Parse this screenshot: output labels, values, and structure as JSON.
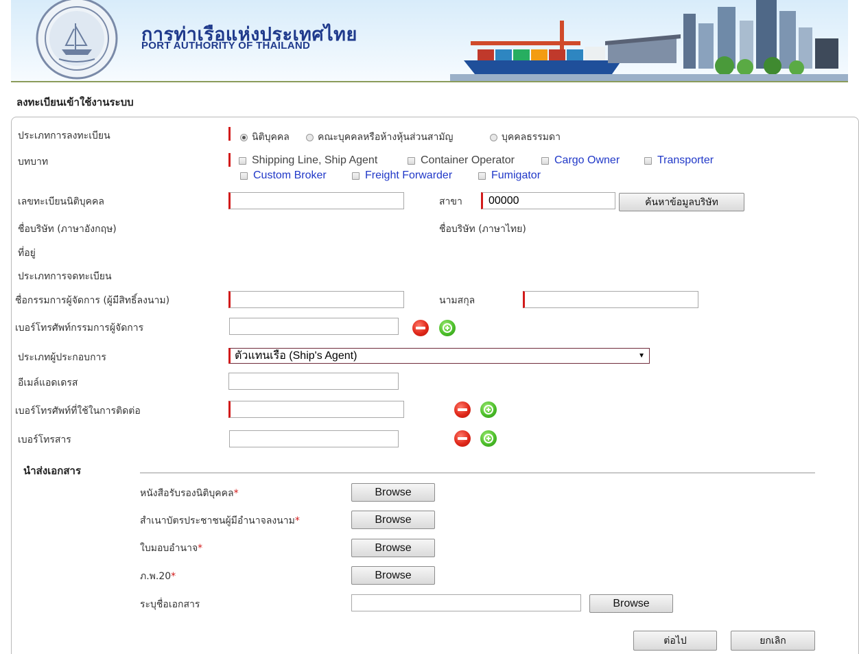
{
  "header": {
    "brand_th": "การท่าเรือแห่งประเทศไทย",
    "brand_en": "PORT AUTHORITY OF THAILAND"
  },
  "page_title": "ลงทะเบียนเข้าใช้งานระบบ",
  "form": {
    "reg_type": {
      "label": "ประเภทการลงทะเบียน",
      "options": [
        "นิติบุคคล",
        "คณะบุคคลหรือห้างหุ้นส่วนสามัญ",
        "บุคคลธรรมดา"
      ],
      "selected": "นิติบุคคล"
    },
    "role": {
      "label": "บทบาท",
      "options": [
        "Shipping Line, Ship Agent",
        "Container Operator",
        "Cargo Owner",
        "Transporter",
        "Custom Broker",
        "Freight Forwarder",
        "Fumigator"
      ]
    },
    "juristic_id": {
      "label": "เลขทะเบียนนิติบุคคล",
      "value": ""
    },
    "branch": {
      "label": "สาขา",
      "value": "00000"
    },
    "search_company_button": "ค้นหาข้อมูลบริษัท",
    "company_name_en": {
      "label": "ชื่อบริษัท (ภาษาอังกฤษ)"
    },
    "company_name_th": {
      "label": "ชื่อบริษัท (ภาษาไทย)"
    },
    "address": {
      "label": "ที่อยู่"
    },
    "registration_type": {
      "label": "ประเภทการจดทะเบียน"
    },
    "director_name": {
      "label": "ชื่อกรรมการผู้จัดการ (ผู้มีสิทธิ์ลงนาม)",
      "value": ""
    },
    "surname": {
      "label": "นามสกุล",
      "value": ""
    },
    "director_phone": {
      "label": "เบอร์โทรศัพท์กรรมการผู้จัดการ",
      "value": ""
    },
    "operator_type": {
      "label": "ประเภทผู้ประกอบการ",
      "value": "ตัวแทนเรือ (Ship's Agent)"
    },
    "email": {
      "label": "อีเมล์แอดเดรส",
      "value": ""
    },
    "contact_phone": {
      "label": "เบอร์โทรศัพท์ที่ใช้ในการติดต่อ",
      "value": ""
    },
    "fax": {
      "label": "เบอร์โทรสาร",
      "value": ""
    }
  },
  "documents": {
    "title": "นำส่งเอกสาร",
    "items": [
      {
        "label": "หนังสือรับรองนิติบุคคล",
        "required_mark": "*",
        "button": "Browse"
      },
      {
        "label": "สำเนาบัตรประชาชนผู้มีอำนาจลงนาม",
        "required_mark": "*",
        "button": "Browse"
      },
      {
        "label": "ใบมอบอำนาจ",
        "required_mark": "*",
        "button": "Browse"
      },
      {
        "label": "ภ.พ.20",
        "required_mark": "*",
        "button": "Browse"
      }
    ],
    "other": {
      "label": "ระบุชื่อเอกสาร",
      "value": "",
      "button": "Browse"
    }
  },
  "actions": {
    "next": "ต่อไป",
    "cancel": "ยกเลิก"
  },
  "colors": {
    "brand_blue": "#1f3a8c",
    "required_red": "#d21a1a",
    "link_blue": "#2038c8"
  }
}
